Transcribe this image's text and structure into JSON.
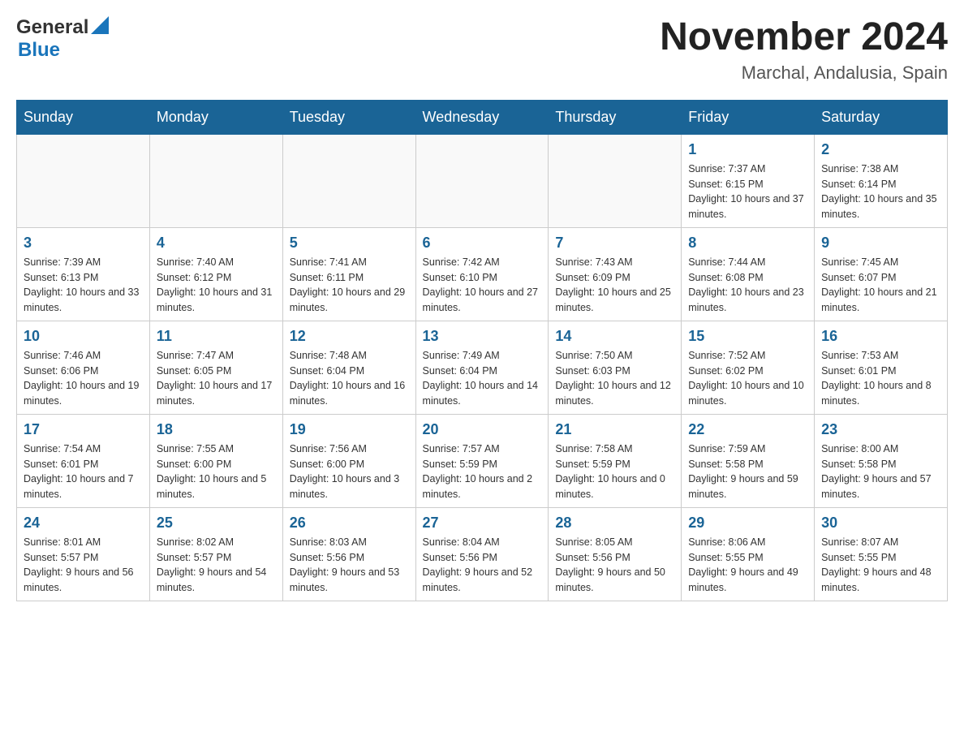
{
  "header": {
    "logo_text_general": "General",
    "logo_text_blue": "Blue",
    "calendar_title": "November 2024",
    "calendar_subtitle": "Marchal, Andalusia, Spain"
  },
  "weekdays": [
    "Sunday",
    "Monday",
    "Tuesday",
    "Wednesday",
    "Thursday",
    "Friday",
    "Saturday"
  ],
  "weeks": [
    [
      {
        "day": "",
        "info": ""
      },
      {
        "day": "",
        "info": ""
      },
      {
        "day": "",
        "info": ""
      },
      {
        "day": "",
        "info": ""
      },
      {
        "day": "",
        "info": ""
      },
      {
        "day": "1",
        "info": "Sunrise: 7:37 AM\nSunset: 6:15 PM\nDaylight: 10 hours and 37 minutes."
      },
      {
        "day": "2",
        "info": "Sunrise: 7:38 AM\nSunset: 6:14 PM\nDaylight: 10 hours and 35 minutes."
      }
    ],
    [
      {
        "day": "3",
        "info": "Sunrise: 7:39 AM\nSunset: 6:13 PM\nDaylight: 10 hours and 33 minutes."
      },
      {
        "day": "4",
        "info": "Sunrise: 7:40 AM\nSunset: 6:12 PM\nDaylight: 10 hours and 31 minutes."
      },
      {
        "day": "5",
        "info": "Sunrise: 7:41 AM\nSunset: 6:11 PM\nDaylight: 10 hours and 29 minutes."
      },
      {
        "day": "6",
        "info": "Sunrise: 7:42 AM\nSunset: 6:10 PM\nDaylight: 10 hours and 27 minutes."
      },
      {
        "day": "7",
        "info": "Sunrise: 7:43 AM\nSunset: 6:09 PM\nDaylight: 10 hours and 25 minutes."
      },
      {
        "day": "8",
        "info": "Sunrise: 7:44 AM\nSunset: 6:08 PM\nDaylight: 10 hours and 23 minutes."
      },
      {
        "day": "9",
        "info": "Sunrise: 7:45 AM\nSunset: 6:07 PM\nDaylight: 10 hours and 21 minutes."
      }
    ],
    [
      {
        "day": "10",
        "info": "Sunrise: 7:46 AM\nSunset: 6:06 PM\nDaylight: 10 hours and 19 minutes."
      },
      {
        "day": "11",
        "info": "Sunrise: 7:47 AM\nSunset: 6:05 PM\nDaylight: 10 hours and 17 minutes."
      },
      {
        "day": "12",
        "info": "Sunrise: 7:48 AM\nSunset: 6:04 PM\nDaylight: 10 hours and 16 minutes."
      },
      {
        "day": "13",
        "info": "Sunrise: 7:49 AM\nSunset: 6:04 PM\nDaylight: 10 hours and 14 minutes."
      },
      {
        "day": "14",
        "info": "Sunrise: 7:50 AM\nSunset: 6:03 PM\nDaylight: 10 hours and 12 minutes."
      },
      {
        "day": "15",
        "info": "Sunrise: 7:52 AM\nSunset: 6:02 PM\nDaylight: 10 hours and 10 minutes."
      },
      {
        "day": "16",
        "info": "Sunrise: 7:53 AM\nSunset: 6:01 PM\nDaylight: 10 hours and 8 minutes."
      }
    ],
    [
      {
        "day": "17",
        "info": "Sunrise: 7:54 AM\nSunset: 6:01 PM\nDaylight: 10 hours and 7 minutes."
      },
      {
        "day": "18",
        "info": "Sunrise: 7:55 AM\nSunset: 6:00 PM\nDaylight: 10 hours and 5 minutes."
      },
      {
        "day": "19",
        "info": "Sunrise: 7:56 AM\nSunset: 6:00 PM\nDaylight: 10 hours and 3 minutes."
      },
      {
        "day": "20",
        "info": "Sunrise: 7:57 AM\nSunset: 5:59 PM\nDaylight: 10 hours and 2 minutes."
      },
      {
        "day": "21",
        "info": "Sunrise: 7:58 AM\nSunset: 5:59 PM\nDaylight: 10 hours and 0 minutes."
      },
      {
        "day": "22",
        "info": "Sunrise: 7:59 AM\nSunset: 5:58 PM\nDaylight: 9 hours and 59 minutes."
      },
      {
        "day": "23",
        "info": "Sunrise: 8:00 AM\nSunset: 5:58 PM\nDaylight: 9 hours and 57 minutes."
      }
    ],
    [
      {
        "day": "24",
        "info": "Sunrise: 8:01 AM\nSunset: 5:57 PM\nDaylight: 9 hours and 56 minutes."
      },
      {
        "day": "25",
        "info": "Sunrise: 8:02 AM\nSunset: 5:57 PM\nDaylight: 9 hours and 54 minutes."
      },
      {
        "day": "26",
        "info": "Sunrise: 8:03 AM\nSunset: 5:56 PM\nDaylight: 9 hours and 53 minutes."
      },
      {
        "day": "27",
        "info": "Sunrise: 8:04 AM\nSunset: 5:56 PM\nDaylight: 9 hours and 52 minutes."
      },
      {
        "day": "28",
        "info": "Sunrise: 8:05 AM\nSunset: 5:56 PM\nDaylight: 9 hours and 50 minutes."
      },
      {
        "day": "29",
        "info": "Sunrise: 8:06 AM\nSunset: 5:55 PM\nDaylight: 9 hours and 49 minutes."
      },
      {
        "day": "30",
        "info": "Sunrise: 8:07 AM\nSunset: 5:55 PM\nDaylight: 9 hours and 48 minutes."
      }
    ]
  ]
}
